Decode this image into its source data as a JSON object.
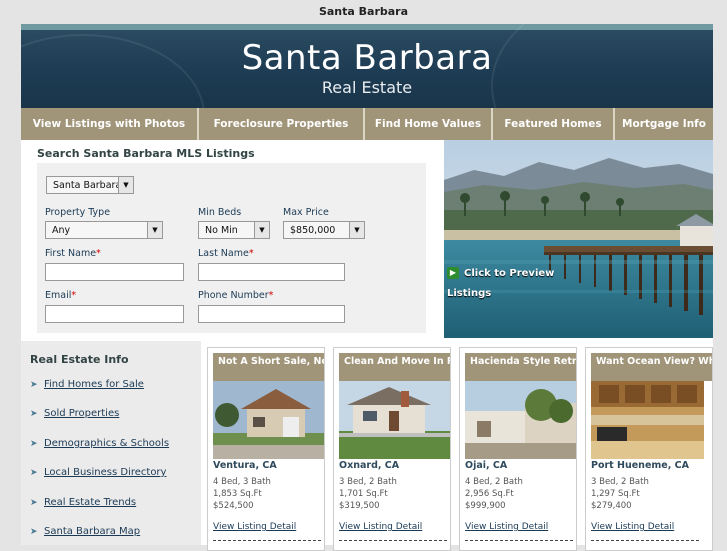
{
  "page_title": "Santa Barbara",
  "banner": {
    "title": "Santa Barbara",
    "subtitle": "Real Estate"
  },
  "nav": [
    "View Listings with Photos",
    "Foreclosure Properties",
    "Find Home Values",
    "Featured Homes",
    "Mortgage Info"
  ],
  "search": {
    "heading": "Search Santa Barbara MLS Listings",
    "city": "Santa Barbara",
    "property_type_label": "Property Type",
    "property_type": "Any",
    "min_beds_label": "Min Beds",
    "min_beds": "No Min",
    "max_price_label": "Max Price",
    "max_price": "$850,000",
    "first_name_label": "First Name",
    "last_name_label": "Last Name",
    "email_label": "Email",
    "phone_label": "Phone Number",
    "required_mark": "*"
  },
  "preview": {
    "label": "Click to Preview Listings"
  },
  "sidebar": {
    "heading": "Real Estate Info",
    "items": [
      "Find Homes for Sale",
      "Sold Properties",
      "Demographics & Schools",
      "Local Business Directory",
      "Real Estate Trends",
      "Santa Barbara Map"
    ]
  },
  "listings": [
    {
      "title": "Not A Short Sale, No",
      "city": "Ventura, CA",
      "beds_baths": "4 Bed, 3 Bath",
      "sqft": "1,853 Sq.Ft",
      "price": "$524,500",
      "link": "View Listing Detail"
    },
    {
      "title": "Clean And Move In Re",
      "city": "Oxnard, CA",
      "beds_baths": "3 Bed, 2 Bath",
      "sqft": "1,701 Sq.Ft",
      "price": "$319,500",
      "link": "View Listing Detail"
    },
    {
      "title": "Hacienda Style Retre",
      "city": "Ojai, CA",
      "beds_baths": "4 Bed, 2 Bath",
      "sqft": "2,956 Sq.Ft",
      "price": "$999,900",
      "link": "View Listing Detail"
    },
    {
      "title": "Want Ocean View? Whe",
      "city": "Port Hueneme, CA",
      "beds_baths": "3 Bed, 2 Bath",
      "sqft": "1,297 Sq.Ft",
      "price": "$279,400",
      "link": "View Listing Detail"
    }
  ],
  "colors": {
    "nav_bg": "#a09479",
    "banner_bg": "#1d3b52",
    "link": "#1b3a55",
    "required": "#cc0000"
  }
}
